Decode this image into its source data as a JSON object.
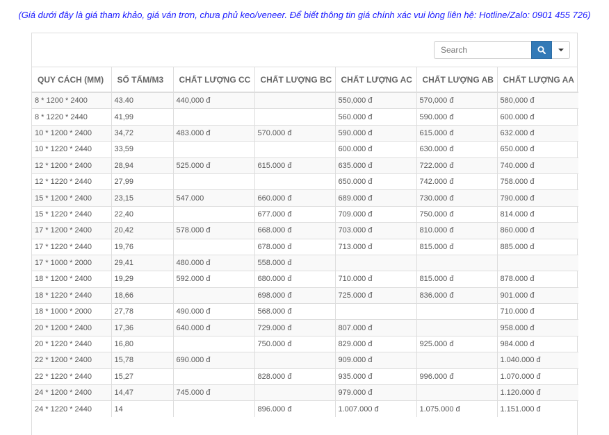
{
  "notice": "(Giá dưới đây là giá tham khảo, giá ván trơn, chưa phủ keo/veneer. Để biết thông tin giá chính xác vui lòng liên hệ: Hotline/Zalo: 0901 455 726)",
  "toolbar": {
    "search_placeholder": "Search"
  },
  "table": {
    "headers": [
      "QUY CÁCH (MM)",
      "SỐ TẤM/M3",
      "CHẤT LƯỢNG CC",
      "CHẤT LƯỢNG BC",
      "CHẤT LƯỢNG AC",
      "CHẤT LƯỢNG AB",
      "CHẤT LƯỢNG AA"
    ],
    "rows": [
      [
        "8 * 1200 * 2400",
        "43.40",
        "440,000 đ",
        "",
        "550,000 đ",
        "570,000 đ",
        "580,000 đ"
      ],
      [
        "8 * 1220 * 2440",
        "41,99",
        "",
        "",
        "560.000 đ",
        "590.000 đ",
        "600.000 đ"
      ],
      [
        "10 * 1200 * 2400",
        "34,72",
        "483.000 đ",
        "570.000 đ",
        "590.000 đ",
        "615.000 đ",
        "632.000 đ"
      ],
      [
        "10 * 1220 * 2440",
        "33,59",
        "",
        "",
        "600.000 đ",
        "630.000 đ",
        "650.000 đ"
      ],
      [
        "12 * 1200 * 2400",
        "28,94",
        "525.000 đ",
        "615.000 đ",
        "635.000 đ",
        "722.000 đ",
        "740.000 đ"
      ],
      [
        "12 * 1220 * 2440",
        "27,99",
        "",
        "",
        "650.000 đ",
        "742.000 đ",
        "758.000 đ"
      ],
      [
        "15 * 1200 * 2400",
        "23,15",
        "547.000",
        "660.000 đ",
        "689.000 đ",
        "730.000 đ",
        "790.000 đ"
      ],
      [
        "15 * 1220 * 2440",
        "22,40",
        "",
        "677.000 đ",
        "709.000 đ",
        "750.000 đ",
        "814.000 đ"
      ],
      [
        "17 * 1200 * 2400",
        "20,42",
        "578.000 đ",
        "668.000 đ",
        "703.000 đ",
        "810.000 đ",
        "860.000 đ"
      ],
      [
        "17 * 1220 * 2440",
        "19,76",
        "",
        "678.000 đ",
        "713.000 đ",
        "815.000 đ",
        "885.000 đ"
      ],
      [
        "17 * 1000 * 2000",
        "29,41",
        "480.000 đ",
        "558.000 đ",
        "",
        "",
        ""
      ],
      [
        "18 * 1200 * 2400",
        "19,29",
        "592.000 đ",
        "680.000 đ",
        "710.000 đ",
        "815.000 đ",
        "878.000 đ"
      ],
      [
        "18 * 1220 * 2440",
        "18,66",
        "",
        "698.000 đ",
        "725.000 đ",
        "836.000 đ",
        "901.000 đ"
      ],
      [
        "18 * 1000 * 2000",
        "27,78",
        "490.000 đ",
        "568.000 đ",
        "",
        "",
        "710.000 đ"
      ],
      [
        "20 * 1200 * 2400",
        "17,36",
        "640.000 đ",
        "729.000 đ",
        "807.000 đ",
        "",
        "958.000 đ"
      ],
      [
        "20 * 1220 * 2440",
        "16,80",
        "",
        "750.000 đ",
        "829.000 đ",
        "925.000 đ",
        "984.000 đ"
      ],
      [
        "22 * 1200 * 2400",
        "15,78",
        "690.000 đ",
        "",
        "909.000 đ",
        "",
        "1.040.000 đ"
      ],
      [
        "22 * 1220 * 2440",
        "15,27",
        "",
        "828.000 đ",
        "935.000 đ",
        "996.000 đ",
        "1.070.000 đ"
      ],
      [
        "24 * 1200 * 2400",
        "14,47",
        "745.000 đ",
        "",
        "979.000 đ",
        "",
        "1.120.000 đ"
      ],
      [
        "24 * 1220 * 2440",
        "14",
        "",
        "896.000 đ",
        "1.007.000 đ",
        "1.075.000 đ",
        "1.151.000 đ"
      ]
    ]
  }
}
